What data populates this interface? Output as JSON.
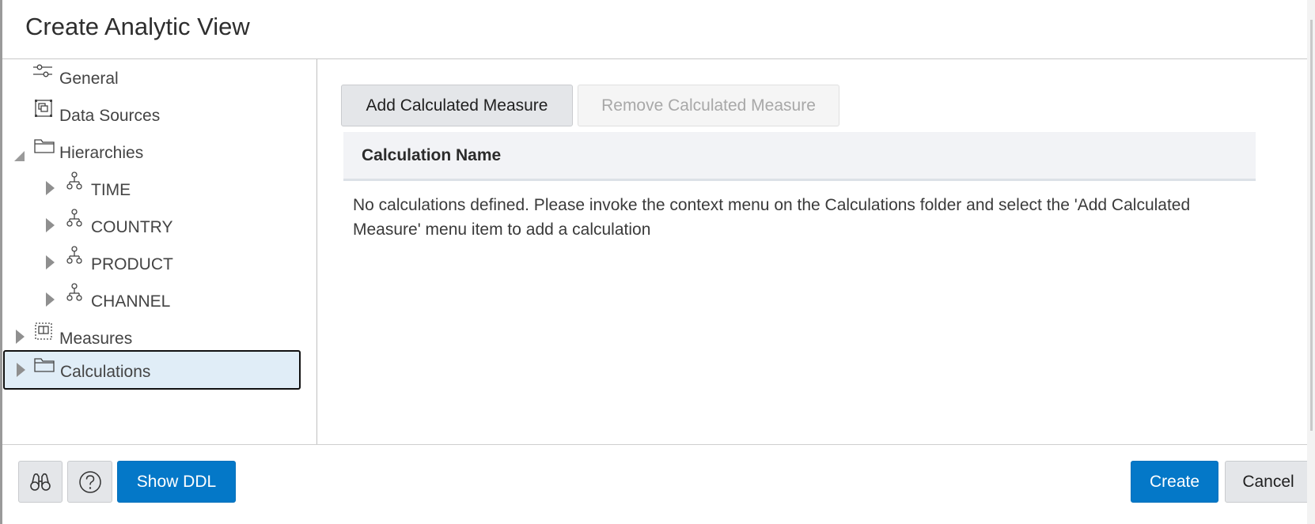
{
  "dialog": {
    "title": "Create Analytic View"
  },
  "sidebar": {
    "items": [
      {
        "label": "General",
        "icon": "sliders-icon",
        "expander": "none"
      },
      {
        "label": "Data Sources",
        "icon": "data-source-icon",
        "expander": "none"
      },
      {
        "label": "Hierarchies",
        "icon": "folder-icon",
        "expander": "expanded"
      },
      {
        "label": "TIME",
        "icon": "hierarchy-icon",
        "expander": "collapsed"
      },
      {
        "label": "COUNTRY",
        "icon": "hierarchy-icon",
        "expander": "collapsed"
      },
      {
        "label": "PRODUCT",
        "icon": "hierarchy-icon",
        "expander": "collapsed"
      },
      {
        "label": "CHANNEL",
        "icon": "hierarchy-icon",
        "expander": "collapsed"
      },
      {
        "label": "Measures",
        "icon": "measures-icon",
        "expander": "collapsed"
      },
      {
        "label": "Calculations",
        "icon": "folder-icon",
        "expander": "collapsed",
        "selected": true
      }
    ]
  },
  "main": {
    "add_button": "Add Calculated Measure",
    "remove_button": "Remove Calculated Measure",
    "table": {
      "columns": [
        "Calculation Name"
      ],
      "rows": [],
      "empty_message": "No calculations defined. Please invoke the context menu on the Calculations folder and select the 'Add Calculated Measure' menu item to add a calculation"
    }
  },
  "footer": {
    "find_icon": "binoculars-icon",
    "help_icon": "help-icon",
    "show_ddl": "Show DDL",
    "create": "Create",
    "cancel": "Cancel"
  },
  "colors": {
    "primary": "#0478c8",
    "selected_bg": "#e0edf7",
    "table_header_bg": "#f2f3f6"
  }
}
